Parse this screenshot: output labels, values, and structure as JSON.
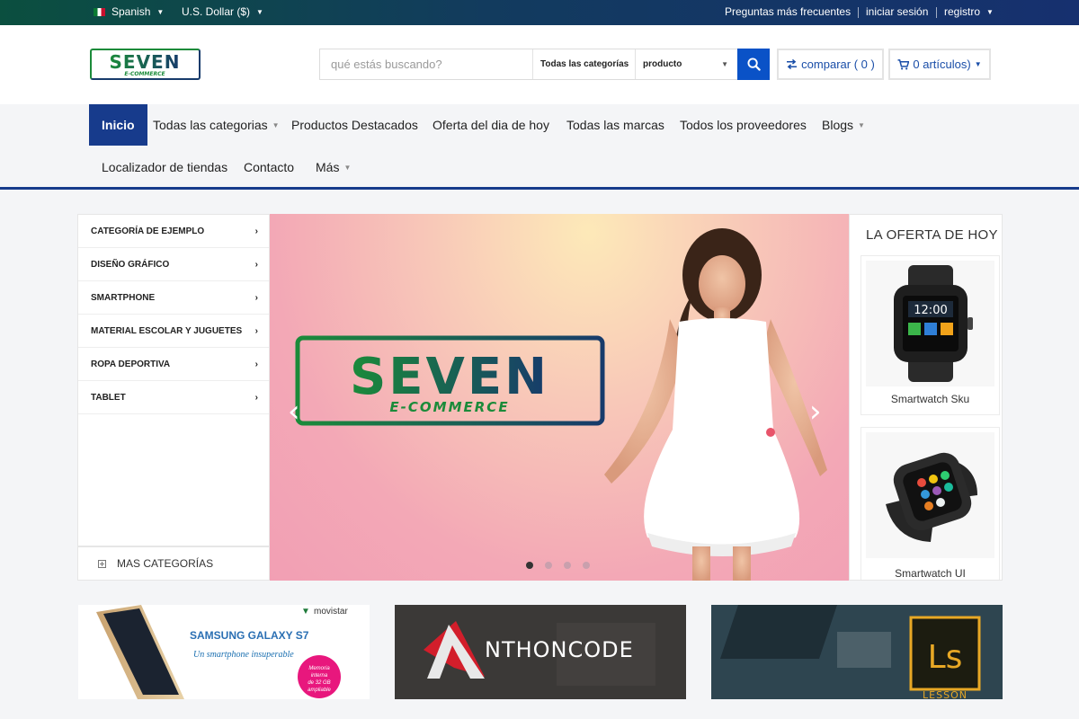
{
  "topbar": {
    "language": "Spanish",
    "currency": "U.S. Dollar ($)",
    "faq": "Preguntas más frecuentes",
    "login": "iniciar sesión",
    "register": "registro"
  },
  "header": {
    "logo_text": "SEVEN",
    "logo_sub": "E-COMMERCE",
    "search_placeholder": "qué estás buscando?",
    "search_category": "Todas las categorías",
    "search_type": "producto",
    "compare_label": "comparar ( 0 )",
    "cart_label": "0 artículos)"
  },
  "nav": {
    "items": [
      {
        "label": "Inicio"
      },
      {
        "label": "Todas las categorias"
      },
      {
        "label": "Productos Destacados"
      },
      {
        "label": "Oferta del dia de hoy"
      },
      {
        "label": "Todas las marcas"
      },
      {
        "label": "Todos los proveedores"
      },
      {
        "label": "Blogs"
      },
      {
        "label": "Localizador de tiendas"
      },
      {
        "label": "Contacto"
      },
      {
        "label": "Más"
      }
    ]
  },
  "sidebar": {
    "items": [
      {
        "label": "CATEGORÍA DE EJEMPLO"
      },
      {
        "label": "DISEÑO GRÁFICO"
      },
      {
        "label": "SMARTPHONE"
      },
      {
        "label": "MATERIAL ESCOLAR Y JUGUETES"
      },
      {
        "label": "ROPA DEPORTIVA"
      },
      {
        "label": "TABLET"
      }
    ],
    "more_label": "MAS CATEGORÍAS"
  },
  "slider": {
    "logo_text": "SEVEN",
    "logo_sub": "E-COMMERCE",
    "slide_count": 4,
    "active_slide": 1
  },
  "deal": {
    "title": "LA OFERTA DE HOY",
    "products": [
      {
        "name": "Smartwatch Sku"
      },
      {
        "name": "Smartwatch UI"
      }
    ]
  },
  "banners": {
    "samsung_brand": "movistar",
    "samsung_title": "SAMSUNG GALAXY S7",
    "samsung_sub": "Un smartphone insuperable",
    "samsung_badge": "Memoria interna de 32 GB ampliable",
    "anthon_a": "A",
    "anthon_text": "NTHONCODE",
    "lesson_logo": "Ls",
    "lesson_text": "LESSON"
  },
  "colors": {
    "brand_blue": "#173b8c",
    "brand_green": "#1b8b3a",
    "accent_button": "#0a52c7"
  }
}
